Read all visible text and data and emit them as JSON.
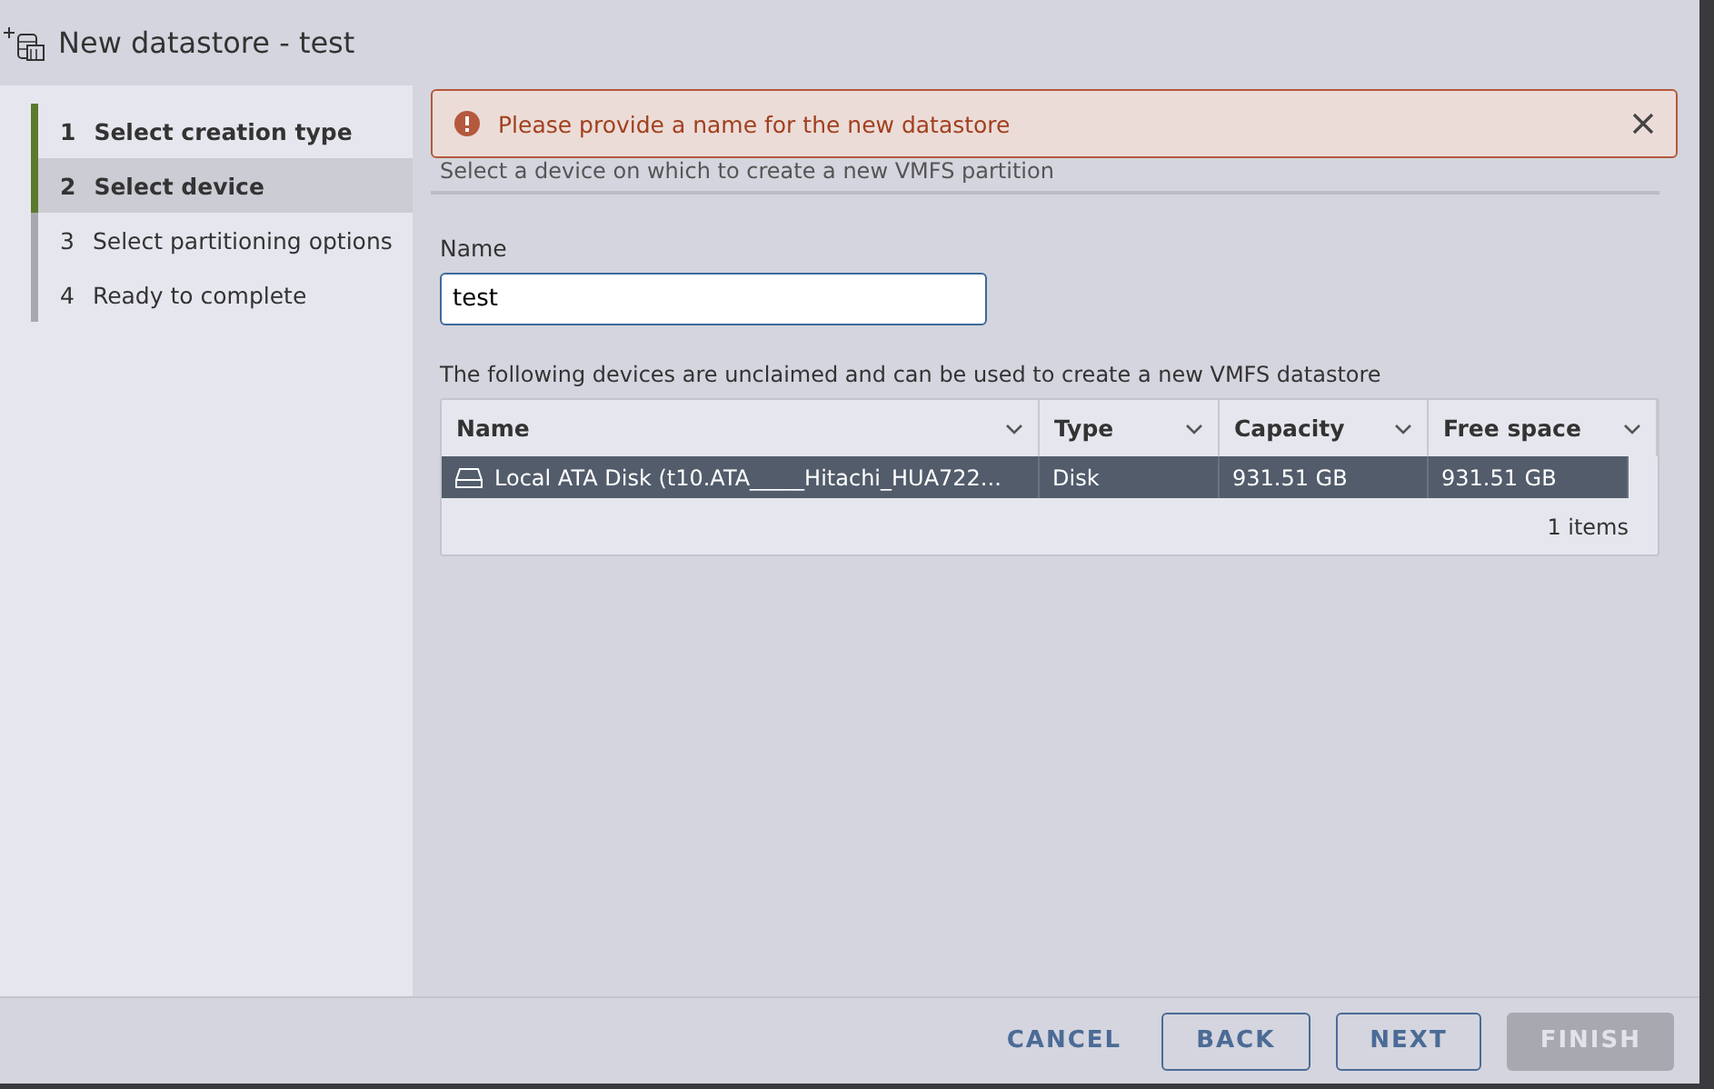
{
  "window": {
    "title": "New datastore - test"
  },
  "steps": [
    {
      "number": "1",
      "label": "Select creation type",
      "done": true,
      "selected": false
    },
    {
      "number": "2",
      "label": "Select device",
      "done": true,
      "selected": true
    },
    {
      "number": "3",
      "label": "Select partitioning options",
      "done": false,
      "selected": false
    },
    {
      "number": "4",
      "label": "Ready to complete",
      "done": false,
      "selected": false
    }
  ],
  "alert": {
    "message": "Please provide a name for the new datastore"
  },
  "subtitle": "Select a device on which to create a new VMFS partition",
  "name_field": {
    "label": "Name",
    "value": "test"
  },
  "devices_note": "The following devices are unclaimed and can be used to create a new VMFS datastore",
  "table": {
    "columns": [
      "Name",
      "Type",
      "Capacity",
      "Free space"
    ],
    "rows": [
      {
        "cells": [
          "Local ATA Disk (t10.ATA_____Hitachi_HUA722...",
          "Disk",
          "931.51 GB",
          "931.51 GB"
        ],
        "selected": true
      }
    ],
    "footer": "1 items"
  },
  "buttons": [
    {
      "label": "CANCEL",
      "kind": "flat",
      "disabled": false
    },
    {
      "label": "BACK",
      "kind": "outline",
      "disabled": false
    },
    {
      "label": "NEXT",
      "kind": "outline",
      "disabled": false
    },
    {
      "label": "FINISH",
      "kind": "solid",
      "disabled": true
    }
  ]
}
